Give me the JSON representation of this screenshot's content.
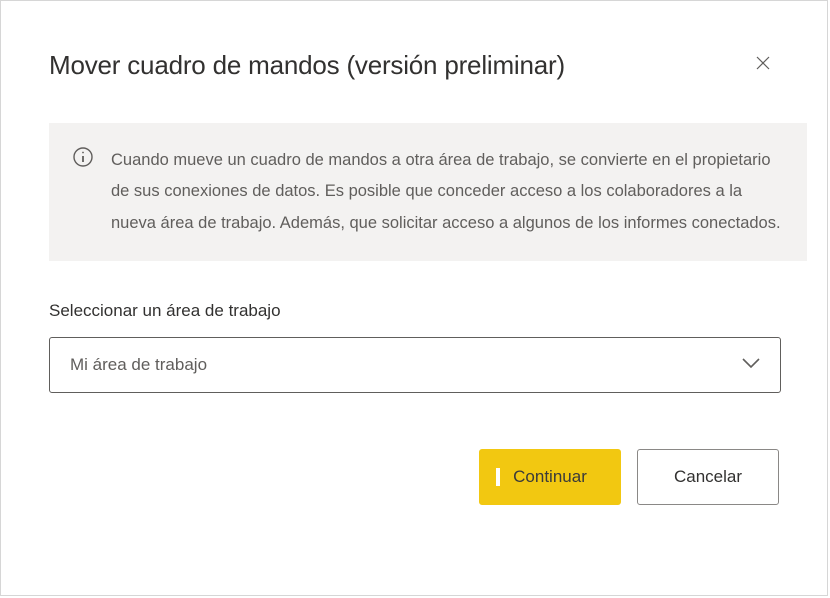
{
  "dialog": {
    "title": "Mover cuadro de mandos (versión preliminar)",
    "info_text": "Cuando mueve un cuadro de mandos a otra área de trabajo, se convierte en el propietario de sus conexiones de datos. Es posible que conceder acceso a los colaboradores a la nueva área de trabajo. Además, que solicitar acceso a algunos de los informes conectados."
  },
  "form": {
    "workspace_label": "Seleccionar un área de trabajo",
    "workspace_selected": "Mi área de trabajo"
  },
  "footer": {
    "continue_label": "Continuar",
    "cancel_label": "Cancelar"
  }
}
